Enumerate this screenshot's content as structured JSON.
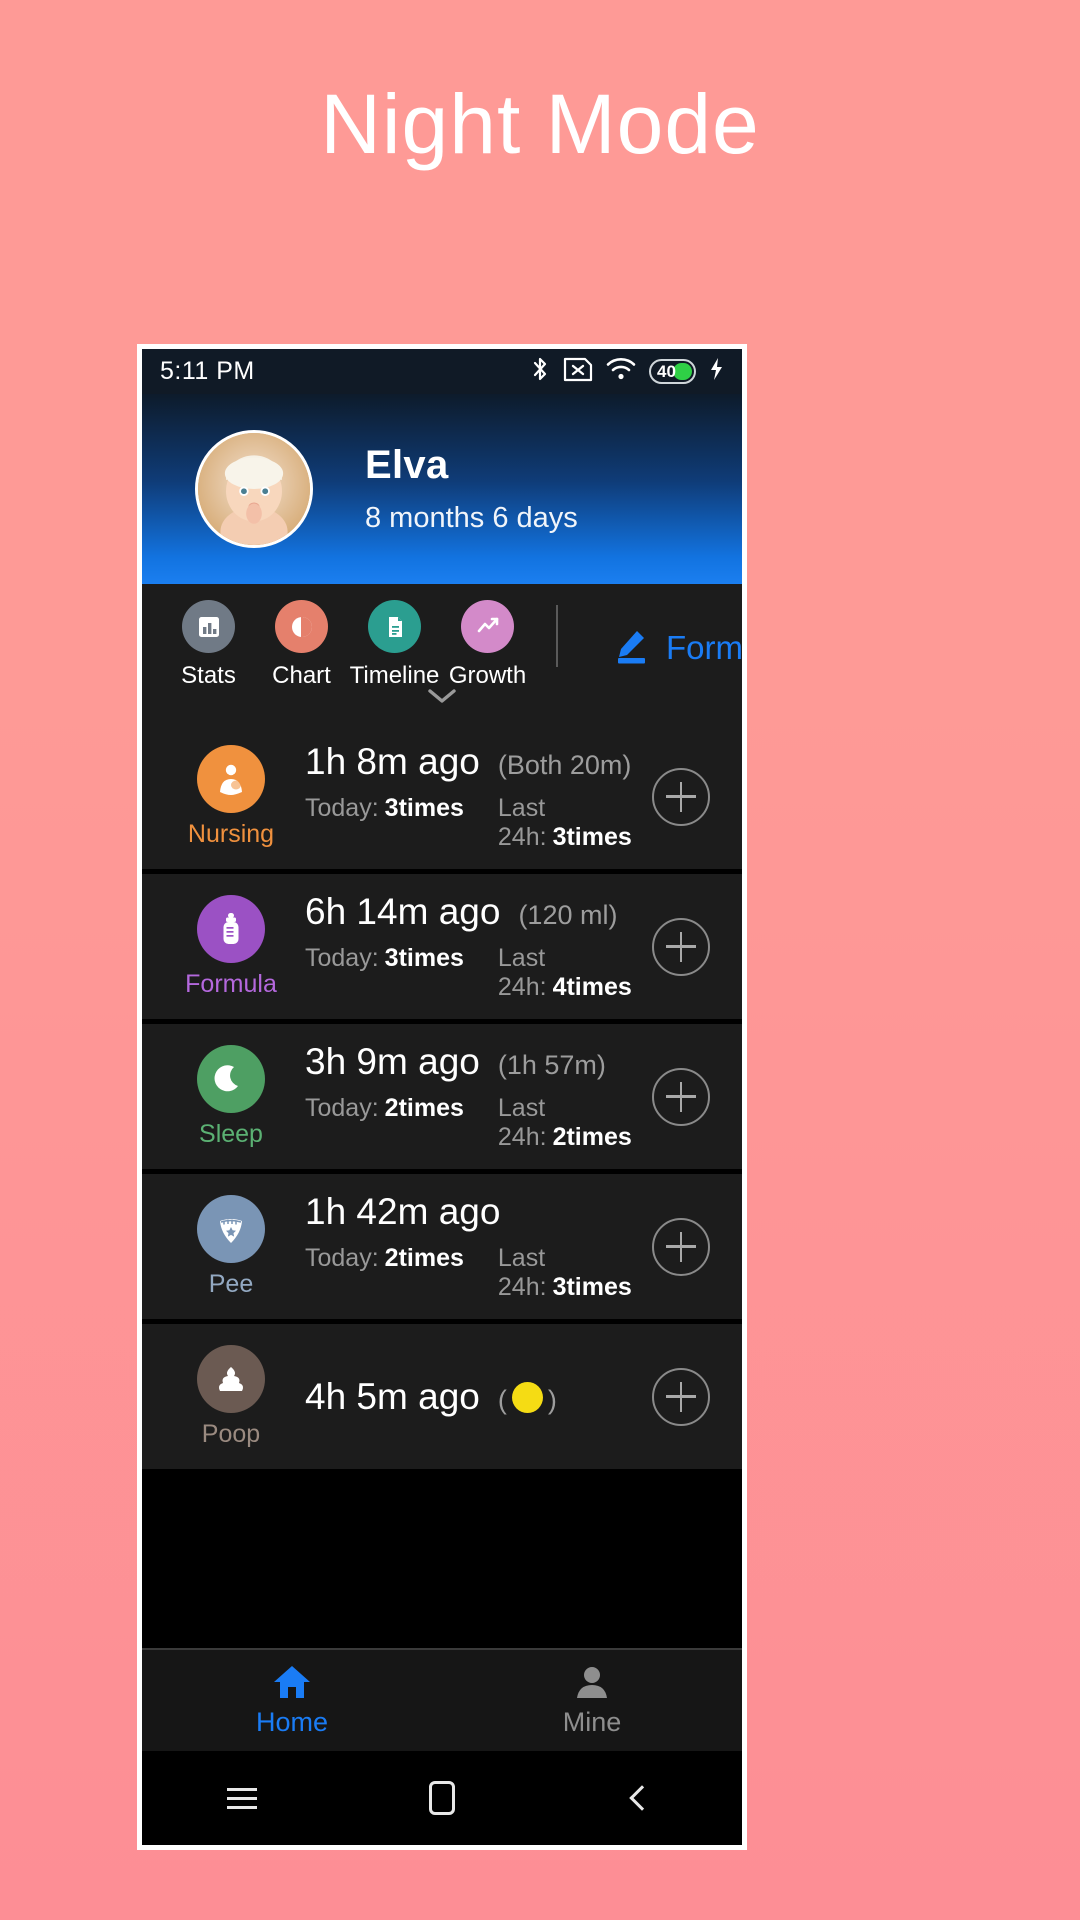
{
  "poster": {
    "title": "Night Mode",
    "background_color": "#fe9a96",
    "title_color": "#ffffff"
  },
  "statusbar": {
    "time": "5:11 PM",
    "bluetooth_icon": "bluetooth-icon",
    "sim_off_icon": "sim-off-icon",
    "wifi_icon": "wifi-icon",
    "battery_level": "40",
    "battery_color": "#2fd046",
    "charging_icon": "lightning-bolt-icon"
  },
  "profile": {
    "name": "Elva",
    "age": "8 months 6 days",
    "avatar_name": "baby-avatar"
  },
  "nav": {
    "items": [
      {
        "label": "Stats",
        "icon": "bar-chart-icon",
        "color": "#707a86"
      },
      {
        "label": "Chart",
        "icon": "pie-chart-icon",
        "color": "#e5806c"
      },
      {
        "label": "Timeline",
        "icon": "document-icon",
        "color": "#2b9e90"
      },
      {
        "label": "Growth",
        "icon": "trend-line-icon",
        "color": "#d38ac9"
      }
    ],
    "form_label": "Form",
    "form_icon": "pencil-edit-icon",
    "form_color": "#1a7cf5",
    "expand_icon": "chevron-down-icon"
  },
  "list": {
    "today_label": "Today:",
    "last24_label": "Last 24h:",
    "add_icon": "plus-circle-icon",
    "rows": [
      {
        "category": "Nursing",
        "icon": "nursing-icon",
        "color": "#f0913e",
        "ago": "1h 8m ago",
        "detail": "(Both 20m)",
        "today_value": "3times",
        "last24_value": "3times"
      },
      {
        "category": "Formula",
        "icon": "bottle-icon",
        "color": "#9b51c4",
        "ago": "6h 14m ago",
        "detail": "(120 ml)",
        "today_value": "3times",
        "last24_value": "4times"
      },
      {
        "category": "Sleep",
        "icon": "moon-icon",
        "color": "#4e9f63",
        "ago": "3h 9m ago",
        "detail": "(1h 57m)",
        "today_value": "2times",
        "last24_value": "2times"
      },
      {
        "category": "Pee",
        "icon": "diaper-icon",
        "color": "#7a95b5",
        "ago": "1h 42m ago",
        "detail": "",
        "today_value": "2times",
        "last24_value": "3times"
      },
      {
        "category": "Poop",
        "icon": "poop-icon",
        "color": "#6b5a52",
        "ago": "4h 5m ago",
        "detail_dot_color": "#f5dc14",
        "today_value": "",
        "last24_value": ""
      }
    ]
  },
  "tabbar": {
    "home_label": "Home",
    "home_icon": "home-icon",
    "home_color": "#1a7cf5",
    "mine_label": "Mine",
    "mine_icon": "person-icon",
    "mine_color": "#8e8e8e"
  },
  "sysnav": {
    "recents_icon": "recents-menu-icon",
    "home_icon": "system-home-icon",
    "back_icon": "system-back-icon"
  }
}
